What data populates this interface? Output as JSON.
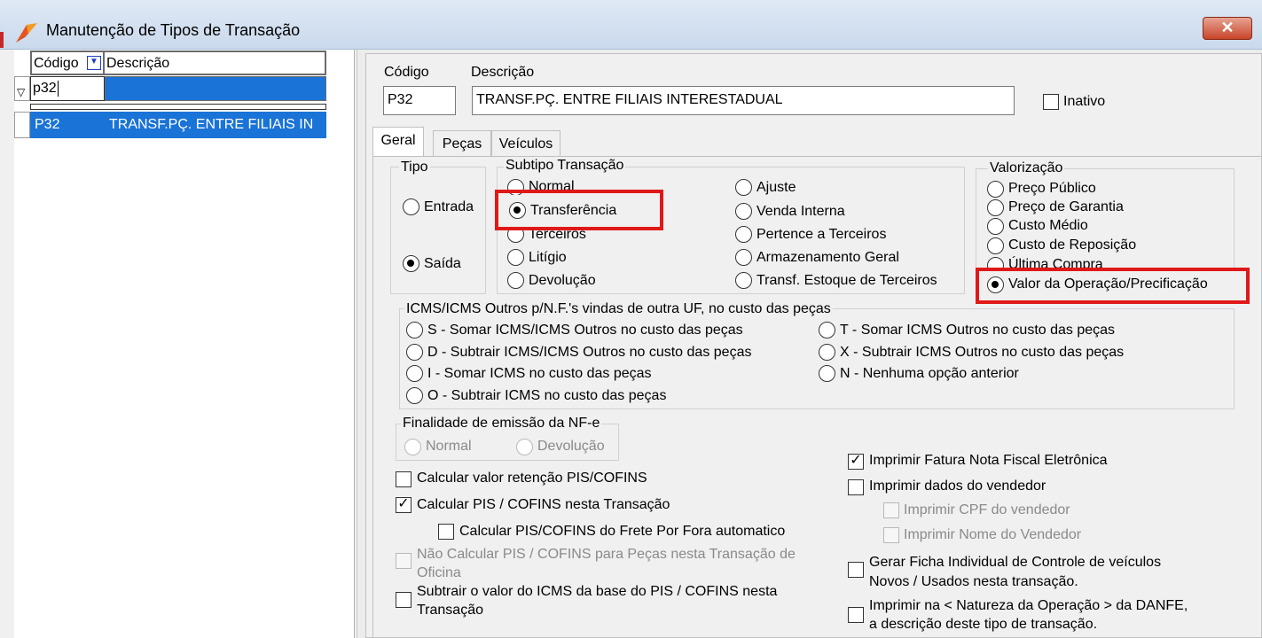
{
  "window": {
    "title": "Manutenção de Tipos de Transação",
    "close_label": "✕"
  },
  "grid": {
    "col_codigo": "Código",
    "col_descricao": "Descrição",
    "filter_value": "p32",
    "rows": [
      {
        "codigo": "P32",
        "descricao": "TRANSF.PÇ. ENTRE FILIAIS IN"
      }
    ]
  },
  "header": {
    "codigo_label": "Código",
    "descricao_label": "Descrição",
    "codigo_value": "P32",
    "descricao_value": "TRANSF.PÇ. ENTRE FILIAIS INTERESTADUAL",
    "inativo_label": "Inativo"
  },
  "tabs": [
    {
      "label": "Geral",
      "active": true
    },
    {
      "label": "Peças",
      "active": false
    },
    {
      "label": "Veículos",
      "active": false
    }
  ],
  "tipo": {
    "legend": "Tipo",
    "options": [
      "Entrada",
      "Saída"
    ],
    "selected": "Saída"
  },
  "subtipo": {
    "legend": "Subtipo Transação",
    "col1": [
      "Normal",
      "Transferência",
      "Terceiros",
      "Litígio",
      "Devolução"
    ],
    "col2": [
      "Ajuste",
      "Venda Interna",
      "Pertence a Terceiros",
      "Armazenamento Geral",
      "Transf. Estoque de Terceiros"
    ],
    "selected": "Transferência"
  },
  "valorizacao": {
    "legend": "Valorização",
    "options": [
      "Preço Público",
      "Preço de Garantia",
      "Custo Médio",
      "Custo de Reposição",
      "Última Compra",
      "Valor da Operação/Precificação"
    ],
    "selected": "Valor da Operação/Precificação"
  },
  "icms": {
    "legend": "ICMS/ICMS Outros p/N.F.'s vindas de outra UF, no custo das peças",
    "col1": [
      "S - Somar ICMS/ICMS Outros no custo das peças",
      "D - Subtrair ICMS/ICMS Outros no custo das peças",
      "I - Somar ICMS no custo das peças",
      "O - Subtrair ICMS no custo das peças"
    ],
    "col2": [
      "T - Somar ICMS Outros no custo das peças",
      "X - Subtrair ICMS Outros no custo das peças",
      "N - Nenhuma opção anterior"
    ]
  },
  "finalidade": {
    "legend": "Finalidade de emissão da NF-e",
    "options": [
      "Normal",
      "Devolução"
    ]
  },
  "left_checks": {
    "retencao": "Calcular valor retenção PIS/COFINS",
    "pis_cofins": "Calcular PIS / COFINS nesta Transação",
    "frete": "Calcular PIS/COFINS do Frete Por Fora automatico",
    "nao_calc_line1": "Não Calcular PIS / COFINS para Peças nesta Transação de",
    "nao_calc_line2": "Oficina",
    "subtrair_line1": "Subtrair o valor do ICMS da base do PIS / COFINS nesta",
    "subtrair_line2": "Transação"
  },
  "right_checks": {
    "fatura": "Imprimir Fatura Nota Fiscal Eletrônica",
    "vendedor": "Imprimir dados do vendedor",
    "cpf": "Imprimir CPF do vendedor",
    "nome": "Imprimir Nome do Vendedor",
    "ficha_line1": "Gerar Ficha Individual de Controle de veículos",
    "ficha_line2": "Novos / Usados  nesta transação.",
    "natureza_line1": "Imprimir na < Natureza da Operação > da DANFE,",
    "natureza_line2": "a descrição deste tipo de transação."
  },
  "colors": {
    "highlight": "#e01818",
    "selection": "#1a73d6"
  }
}
